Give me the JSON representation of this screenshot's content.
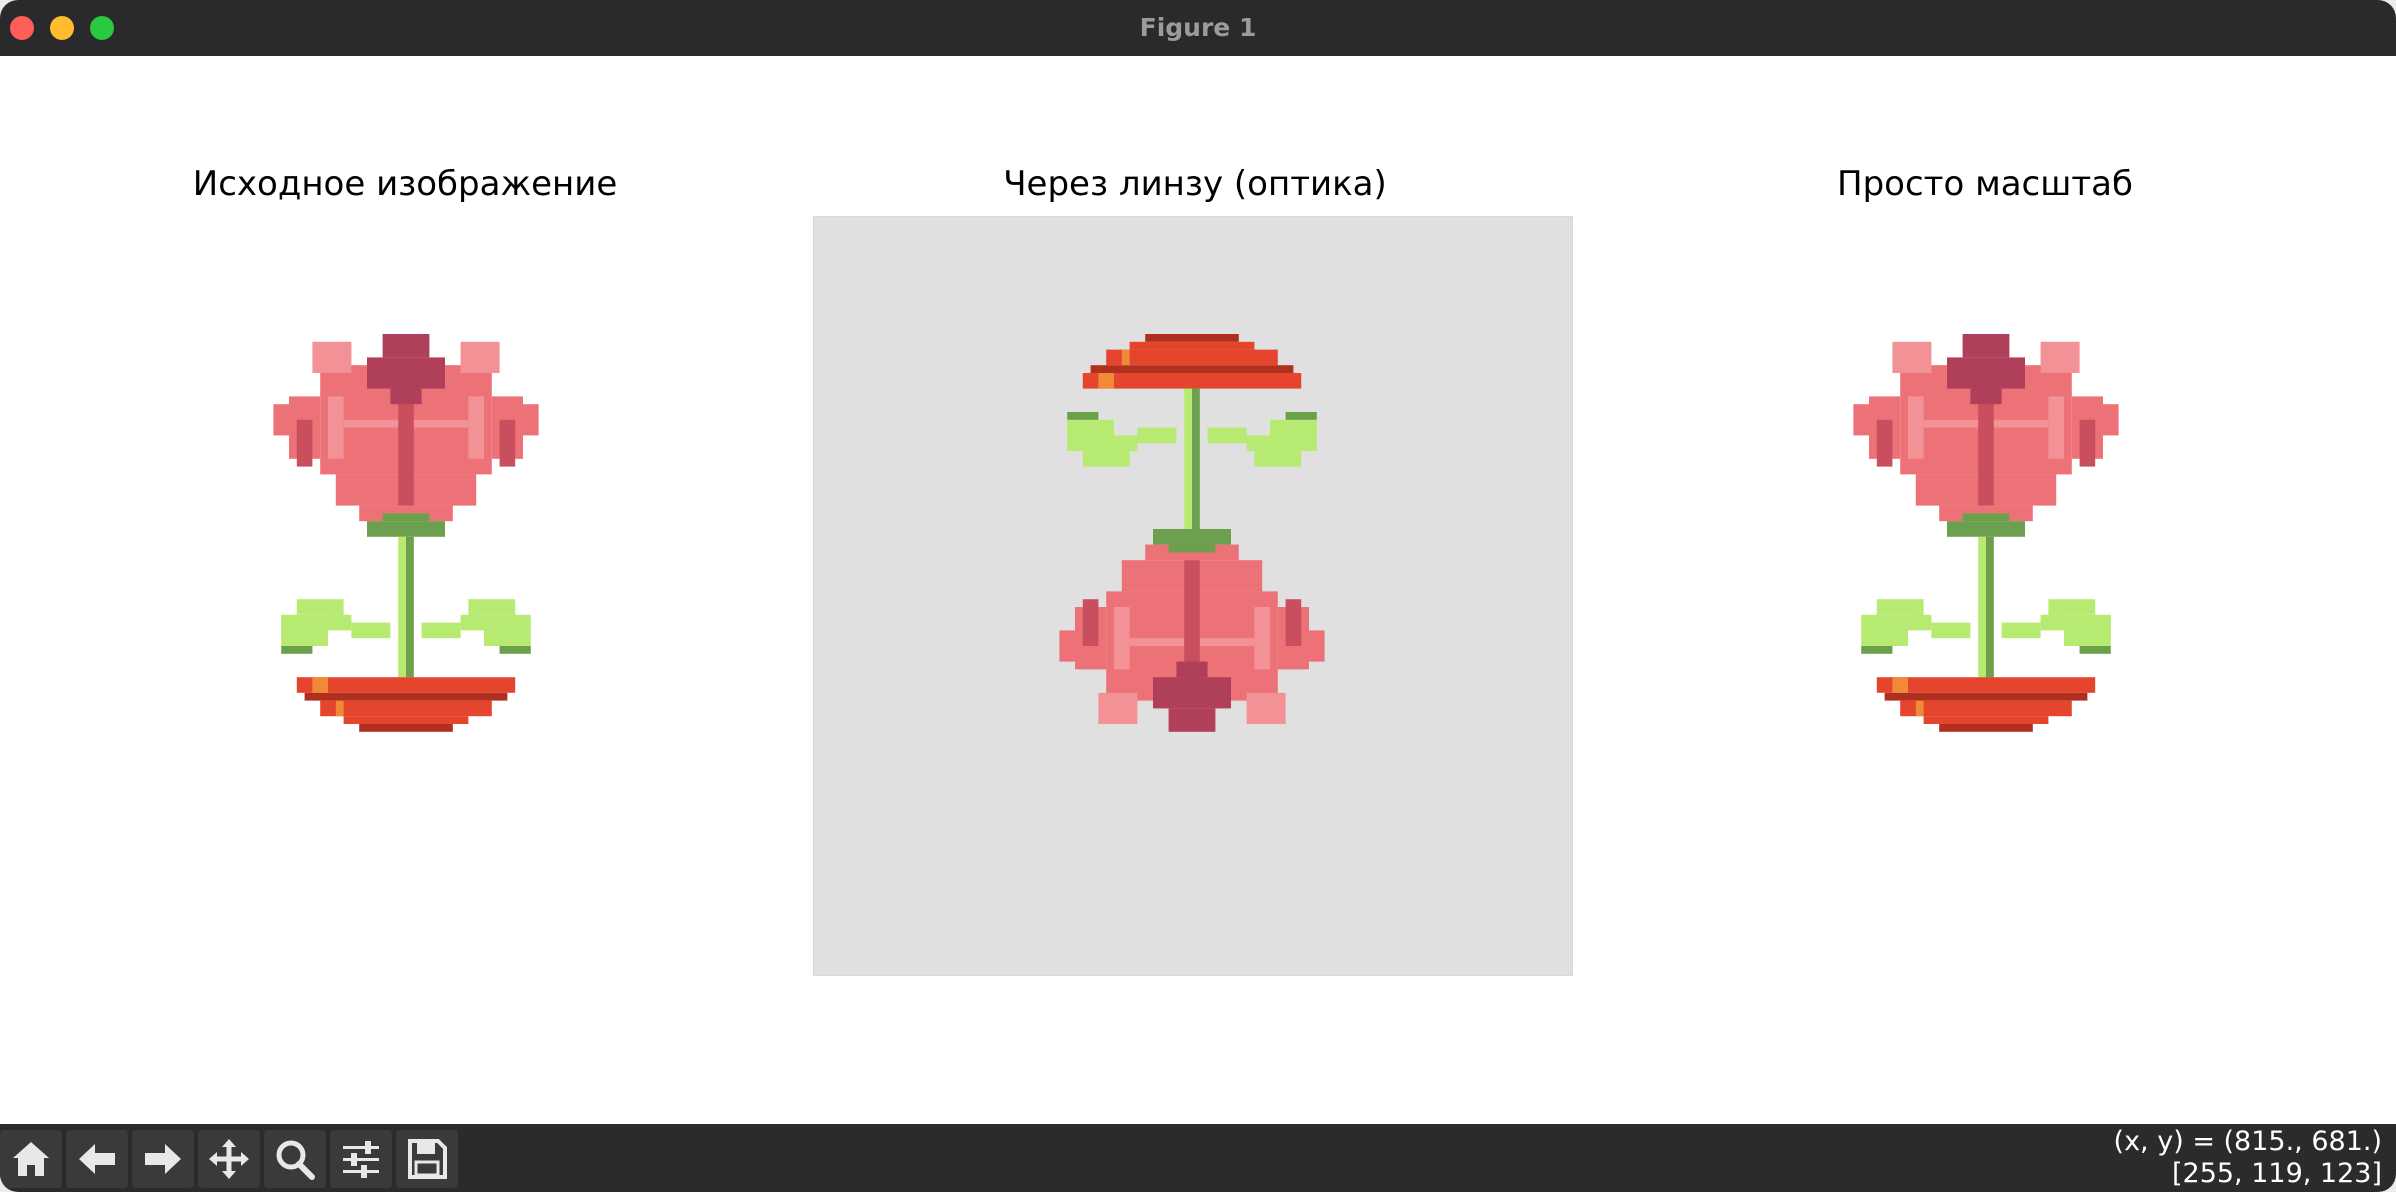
{
  "window": {
    "title": "Figure 1",
    "traffic_lights": [
      "close",
      "minimize",
      "zoom"
    ]
  },
  "figure": {
    "subplots": [
      {
        "title": "Исходное изображение",
        "image": "pixel-art red tulip in a pot",
        "orientation": "upright",
        "background": "#ffffff"
      },
      {
        "title": "Через линзу (оптика)",
        "image": "pixel-art red tulip in a pot",
        "orientation": "inverted",
        "background": "#e0e0e0"
      },
      {
        "title": "Просто масштаб",
        "image": "pixel-art red tulip in a pot",
        "orientation": "upright",
        "background": "#ffffff"
      }
    ]
  },
  "toolbar": {
    "tools": [
      {
        "name": "home",
        "icon": "home-icon"
      },
      {
        "name": "back",
        "icon": "arrow-left-icon"
      },
      {
        "name": "forward",
        "icon": "arrow-right-icon"
      },
      {
        "name": "pan",
        "icon": "move-icon"
      },
      {
        "name": "zoom",
        "icon": "magnifier-icon"
      },
      {
        "name": "configure subplots",
        "icon": "sliders-icon"
      },
      {
        "name": "save",
        "icon": "floppy-disk-icon"
      }
    ]
  },
  "status": {
    "coords": "(x, y) = (815., 681.)",
    "pixel_value": "[255, 119, 123]"
  },
  "colors": {
    "petal_light": "#ec7278",
    "petal_highlight": "#f29196",
    "petal_dark": "#c94f5e",
    "bud": "#b0405a",
    "stem": "#6da04e",
    "leaf_light": "#b7ea71",
    "leaf_dark": "#6aa04a",
    "pot": "#e5452d",
    "pot_dark": "#b0301f",
    "pot_accent": "#f18a36",
    "lens_background": "#e0e0e0"
  }
}
